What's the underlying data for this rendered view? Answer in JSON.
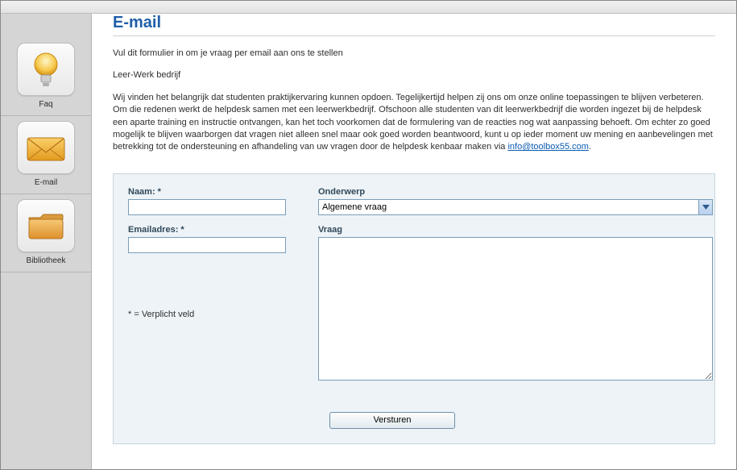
{
  "sidebar": {
    "items": [
      {
        "label": "Faq"
      },
      {
        "label": "E-mail"
      },
      {
        "label": "Bibliotheek"
      }
    ]
  },
  "page": {
    "title": "E-mail",
    "intro1": "Vul dit formulier in om je vraag per email aan ons te stellen",
    "intro2": "Leer-Werk bedrijf",
    "intro3_before": "Wij vinden het belangrijk dat studenten praktijkervaring kunnen opdoen. Tegelijkertijd helpen zij ons om onze online toepassingen te blijven verbeteren. Om die redenen werkt de helpdesk samen met een leerwerkbedrijf. Ofschoon alle studenten van dit leerwerkbedrijf die worden ingezet bij de helpdesk een aparte training en instructie ontvangen, kan het toch voorkomen dat de formulering van de reacties nog wat aanpassing behoeft. Om echter zo goed mogelijk te blijven waarborgen dat vragen niet alleen snel maar ook goed worden beantwoord, kunt u op ieder moment uw mening en aanbevelingen met betrekking tot de ondersteuning en afhandeling van uw vragen door de helpdesk kenbaar maken via ",
    "intro3_link": "info@toolbox55.com",
    "intro3_after": "."
  },
  "form": {
    "name_label": "Naam: *",
    "name_value": "",
    "email_label": "Emailadres: *",
    "email_value": "",
    "subject_label": "Onderwerp",
    "subject_value": "Algemene vraag",
    "subject_options": [
      "Algemene vraag"
    ],
    "question_label": "Vraag",
    "question_value": "",
    "required_note": "* = Verplicht veld",
    "submit_label": "Versturen"
  }
}
